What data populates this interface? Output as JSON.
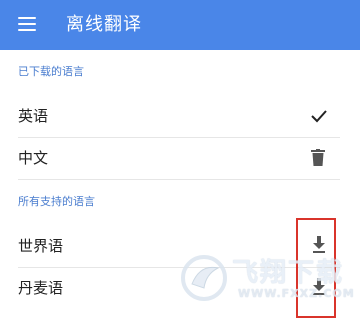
{
  "appbar": {
    "title": "离线翻译",
    "menu_icon": "hamburger-menu-icon",
    "color": "#4a86e8"
  },
  "downloaded": {
    "header": "已下载的语言",
    "items": [
      {
        "label": "英语",
        "icon": "check-icon"
      },
      {
        "label": "中文",
        "icon": "trash-icon"
      }
    ]
  },
  "supported": {
    "header": "所有支持的语言",
    "items": [
      {
        "label": "世界语",
        "icon": "download-icon"
      },
      {
        "label": "丹麦语",
        "icon": "download-icon"
      }
    ]
  },
  "highlight": {
    "color": "#d9342b"
  },
  "watermark": {
    "text": "飞翔下载",
    "url": "WWW.FXXZ.COM"
  }
}
